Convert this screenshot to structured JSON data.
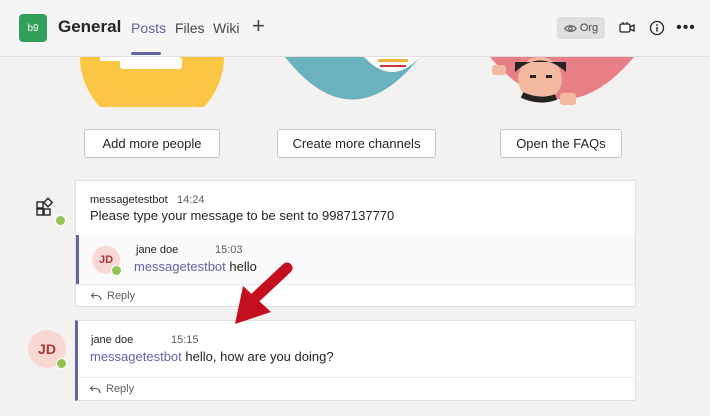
{
  "header": {
    "team_initials": "b9",
    "channel_title": "General",
    "tabs": [
      {
        "label": "Posts",
        "active": true
      },
      {
        "label": "Files",
        "active": false
      },
      {
        "label": "Wiki",
        "active": false
      }
    ],
    "add_tab_symbol": "+",
    "org_label": "Org",
    "icons": [
      "eye-icon",
      "meet-now-icon",
      "info-icon",
      "more-options-icon"
    ]
  },
  "actions": {
    "add_people": "Add more people",
    "create_channels": "Create more channels",
    "open_faqs": "Open the FAQs"
  },
  "thread1": {
    "sender": "messagetestbot",
    "time": "14:24",
    "text": "Please type your message to be sent to 9987137770",
    "reply": {
      "avatar_initials": "JD",
      "sender": "jane doe",
      "time": "15:03",
      "mention": "messagetestbot",
      "text": "hello"
    },
    "reply_label": "Reply"
  },
  "thread2": {
    "avatar_initials": "JD",
    "sender": "jane doe",
    "time": "15:15",
    "mention": "messagetestbot",
    "text": "hello, how are you doing?",
    "reply_label": "Reply"
  },
  "colors": {
    "accent": "#6264a7",
    "team_tile": "#33a05a",
    "presence": "#92c353",
    "arrow": "#c50f1f"
  }
}
